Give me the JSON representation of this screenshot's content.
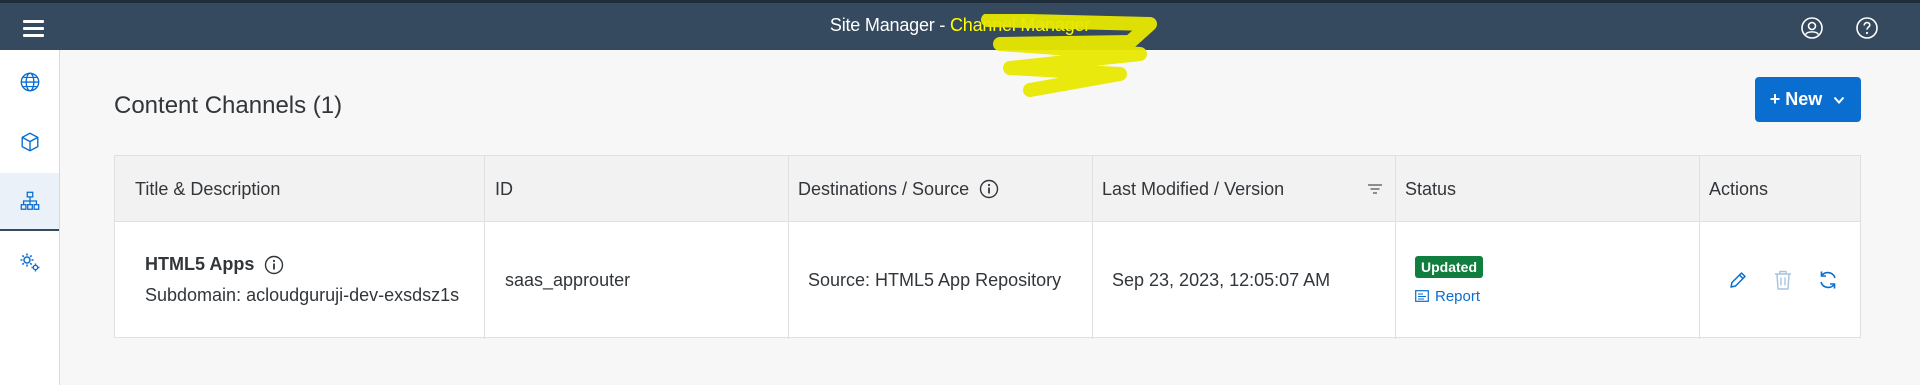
{
  "shell": {
    "title_prefix": "Site Manager - ",
    "title_highlight": "Channel Manager"
  },
  "page": {
    "title": "Content Channels (1)",
    "new_button_label": "+ New"
  },
  "table": {
    "columns": [
      "Title & Description",
      "ID",
      "Destinations / Source",
      "Last Modified / Version",
      "Status",
      "Actions"
    ],
    "rows": [
      {
        "title": "HTML5 Apps",
        "description": "Subdomain: acloudguruji-dev-exsdsz1s",
        "id": "saas_approuter",
        "source": "Source: HTML5 App Repository",
        "modified": "Sep 23, 2023, 12:05:07 AM",
        "status": "Updated",
        "report_label": "Report"
      }
    ]
  },
  "colors": {
    "shell_bg": "#354a5f",
    "accent": "#0a6ed1",
    "status_success": "#107e3e",
    "highlight": "#ffff00"
  },
  "icons": {
    "menu": "hamburger-icon",
    "user": "user-circle-icon",
    "help": "help-circle-icon",
    "nav": [
      "globe-icon",
      "cube-icon",
      "sitemap-icon",
      "gears-icon"
    ],
    "actions": [
      "edit-icon",
      "delete-icon",
      "refresh-icon"
    ]
  }
}
